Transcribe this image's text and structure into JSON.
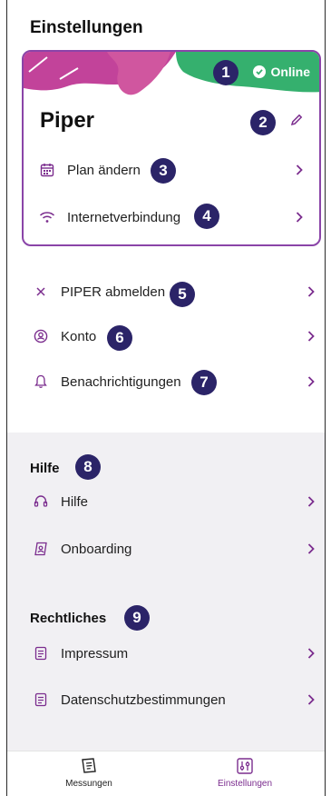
{
  "header": {
    "title": "Einstellungen"
  },
  "device_card": {
    "status_label": "Online",
    "device_name": "Piper",
    "rows": [
      {
        "label": "Plan ändern",
        "icon": "calendar-icon"
      },
      {
        "label": "Internetverbindung",
        "icon": "wifi-icon"
      }
    ]
  },
  "menu": [
    {
      "label": "PIPER abmelden",
      "icon": "close-icon"
    },
    {
      "label": "Konto",
      "icon": "account-icon"
    },
    {
      "label": "Benachrichtigungen",
      "icon": "bell-icon"
    }
  ],
  "help_section": {
    "title": "Hilfe",
    "items": [
      {
        "label": "Hilfe",
        "icon": "headset-icon"
      },
      {
        "label": "Onboarding",
        "icon": "onboarding-icon"
      }
    ]
  },
  "legal_section": {
    "title": "Rechtliches",
    "items": [
      {
        "label": "Impressum",
        "icon": "document-icon"
      },
      {
        "label": "Datenschutzbestimmungen",
        "icon": "document-icon"
      }
    ]
  },
  "annotations": [
    "1",
    "2",
    "3",
    "4",
    "5",
    "6",
    "7",
    "8",
    "9"
  ],
  "tabbar": {
    "tabs": [
      {
        "label": "Messungen",
        "active": false
      },
      {
        "label": "Einstellungen",
        "active": true
      }
    ]
  },
  "colors": {
    "accent": "#7b2d8e",
    "online_green": "#35b06e",
    "badge": "#2b2468",
    "deco_pink": "#c2439a",
    "section_bg": "#f1f0f3"
  }
}
